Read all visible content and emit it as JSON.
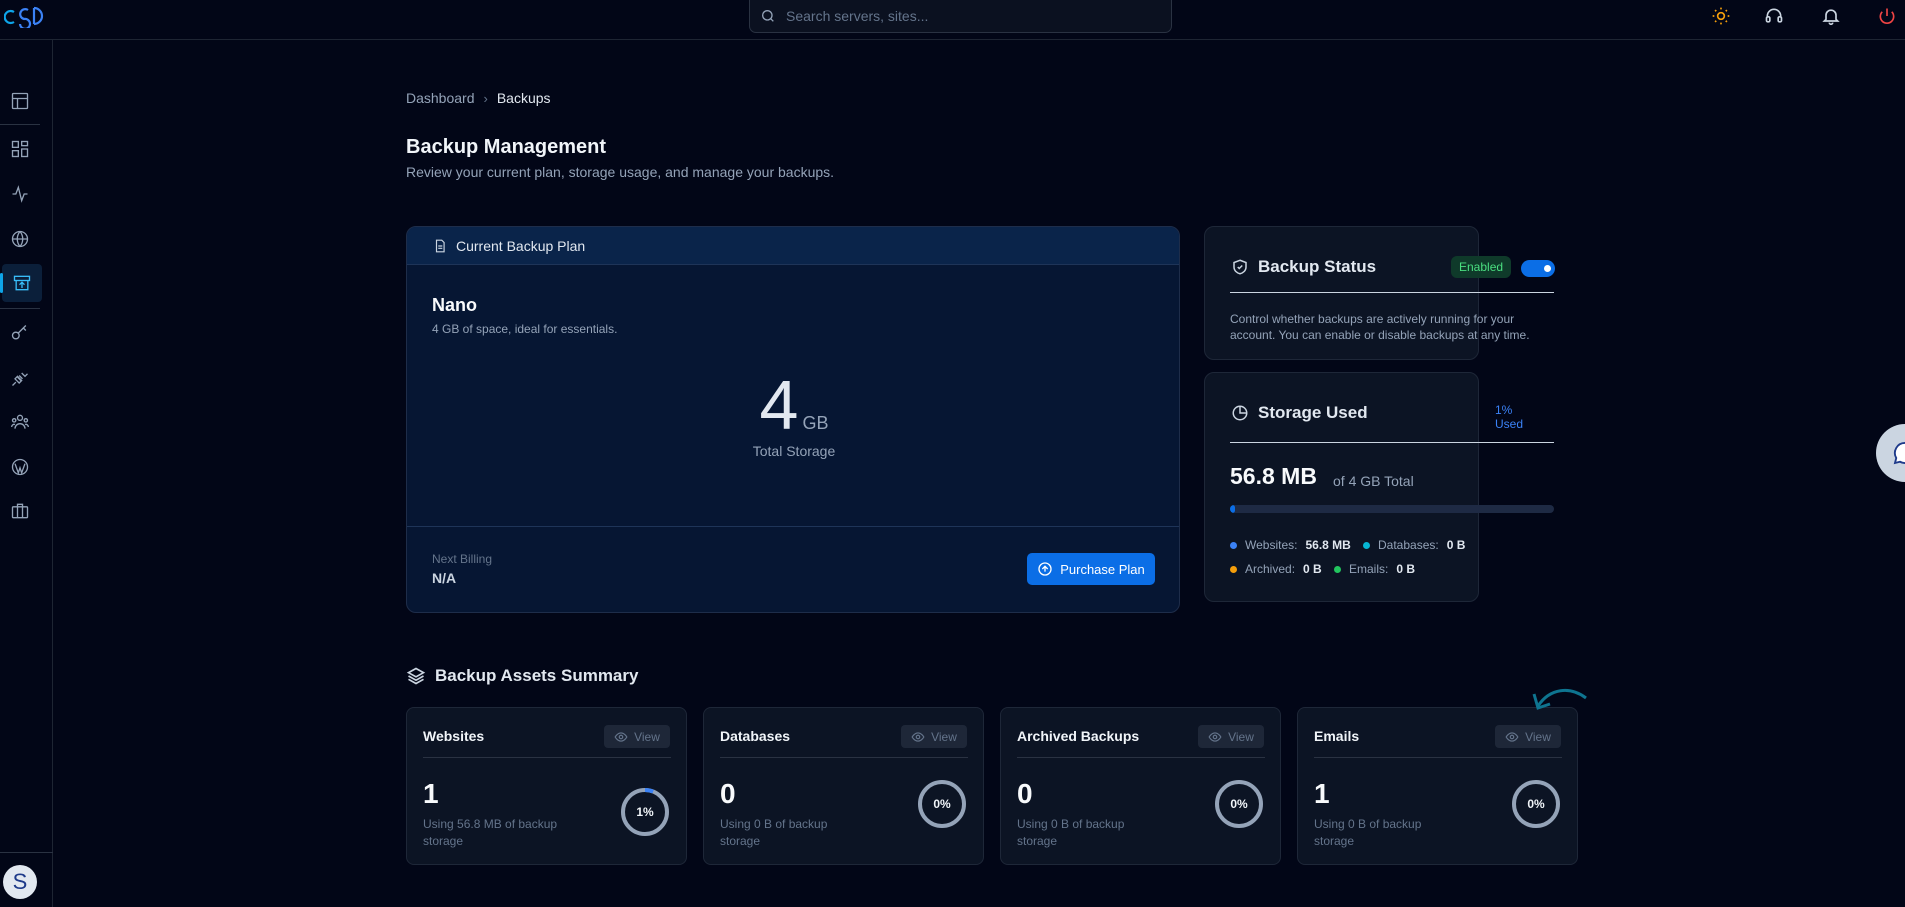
{
  "search": {
    "placeholder": "Search servers, sites..."
  },
  "breadcrumb": {
    "parent": "Dashboard",
    "separator": "›",
    "current": "Backups"
  },
  "header": {
    "title": "Backup Management",
    "subtitle": "Review your current plan, storage usage, and manage your backups."
  },
  "plan": {
    "section_label": "Current Backup Plan",
    "name": "Nano",
    "description": "4 GB of space, ideal for essentials.",
    "size_value": "4",
    "size_unit": "GB",
    "size_label": "Total Storage",
    "billing_label": "Next Billing",
    "billing_value": "N/A",
    "purchase_label": "Purchase Plan"
  },
  "status": {
    "title": "Backup Status",
    "badge": "Enabled",
    "toggle_on": true,
    "description": "Control whether backups are actively running for your account. You can enable or disable backups at any time."
  },
  "storage": {
    "title": "Storage Used",
    "badge": "1% Used",
    "used": "56.8 MB",
    "total": "of 4 GB Total",
    "progress_percent": 1,
    "breakdown": [
      {
        "label": "Websites:",
        "value": "56.8 MB",
        "color": "#3b82f6"
      },
      {
        "label": "Databases:",
        "value": "0 B",
        "color": "#06b6d4"
      },
      {
        "label": "Archived:",
        "value": "0 B",
        "color": "#f59e0b"
      },
      {
        "label": "Emails:",
        "value": "0 B",
        "color": "#22c55e"
      }
    ]
  },
  "assets": {
    "title": "Backup Assets Summary",
    "view_label": "View",
    "cards": [
      {
        "name": "Websites",
        "count": "1",
        "using": "Using 56.8 MB of backup storage",
        "percent_label": "1%",
        "percent": 1
      },
      {
        "name": "Databases",
        "count": "0",
        "using": "Using 0 B of backup storage",
        "percent_label": "0%",
        "percent": 0
      },
      {
        "name": "Archived Backups",
        "count": "0",
        "using": "Using 0 B of backup storage",
        "percent_label": "0%",
        "percent": 0
      },
      {
        "name": "Emails",
        "count": "1",
        "using": "Using 0 B of backup storage",
        "percent_label": "0%",
        "percent": 0
      }
    ]
  },
  "user": {
    "avatar_initial": "S"
  },
  "colors": {
    "accent": "#0b6ee6",
    "background": "#020617",
    "power": "#ef4444",
    "sun": "#f59e0b"
  }
}
